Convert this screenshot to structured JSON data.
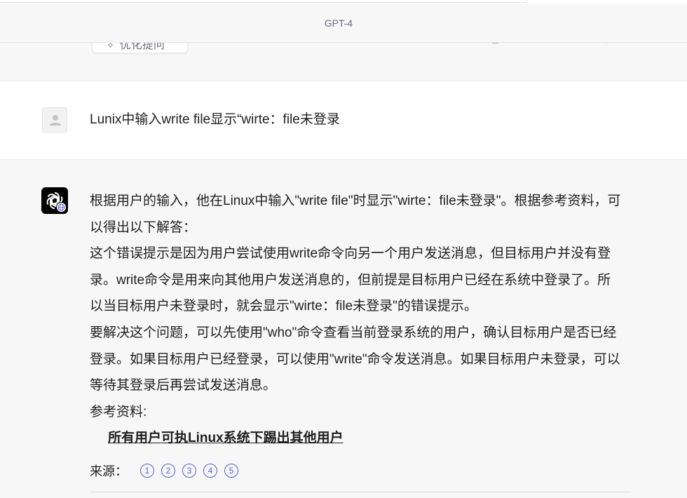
{
  "header": {
    "model": "GPT-4"
  },
  "previous": {
    "pill_label": "优化提问",
    "pill_icon": "magic-wand-icon"
  },
  "user": {
    "avatar_icon": "user-icon",
    "message": "Lunix中输入write file显示“wirte：file未登录"
  },
  "assistant": {
    "avatar_icon": "openai-logo-icon",
    "badge_icon": "globe-icon",
    "paragraphs": [
      "根据用户的输入，他在Linux中输入\"write file\"时显示\"wirte：file未登录\"。根据参考资料，可以得出以下解答：",
      "这个错误提示是因为用户尝试使用write命令向另一个用户发送消息，但目标用户并没有登录。write命令是用来向其他用户发送消息的，但前提是目标用户已经在系统中登录了。所以当目标用户未登录时，就会显示\"wirte：file未登录\"的错误提示。",
      "要解决这个问题，可以先使用\"who\"命令查看当前登录系统的用户，确认目标用户是否已经登录。如果目标用户已经登录，可以使用\"write\"命令发送消息。如果目标用户未登录，可以等待其登录后再尝试发送消息。",
      "参考资料:"
    ],
    "reference_link": "所有用户可执Linux系统下踢出其他用户",
    "sources_label": "来源：",
    "sources": [
      "1",
      "2",
      "3",
      "4",
      "5"
    ]
  }
}
